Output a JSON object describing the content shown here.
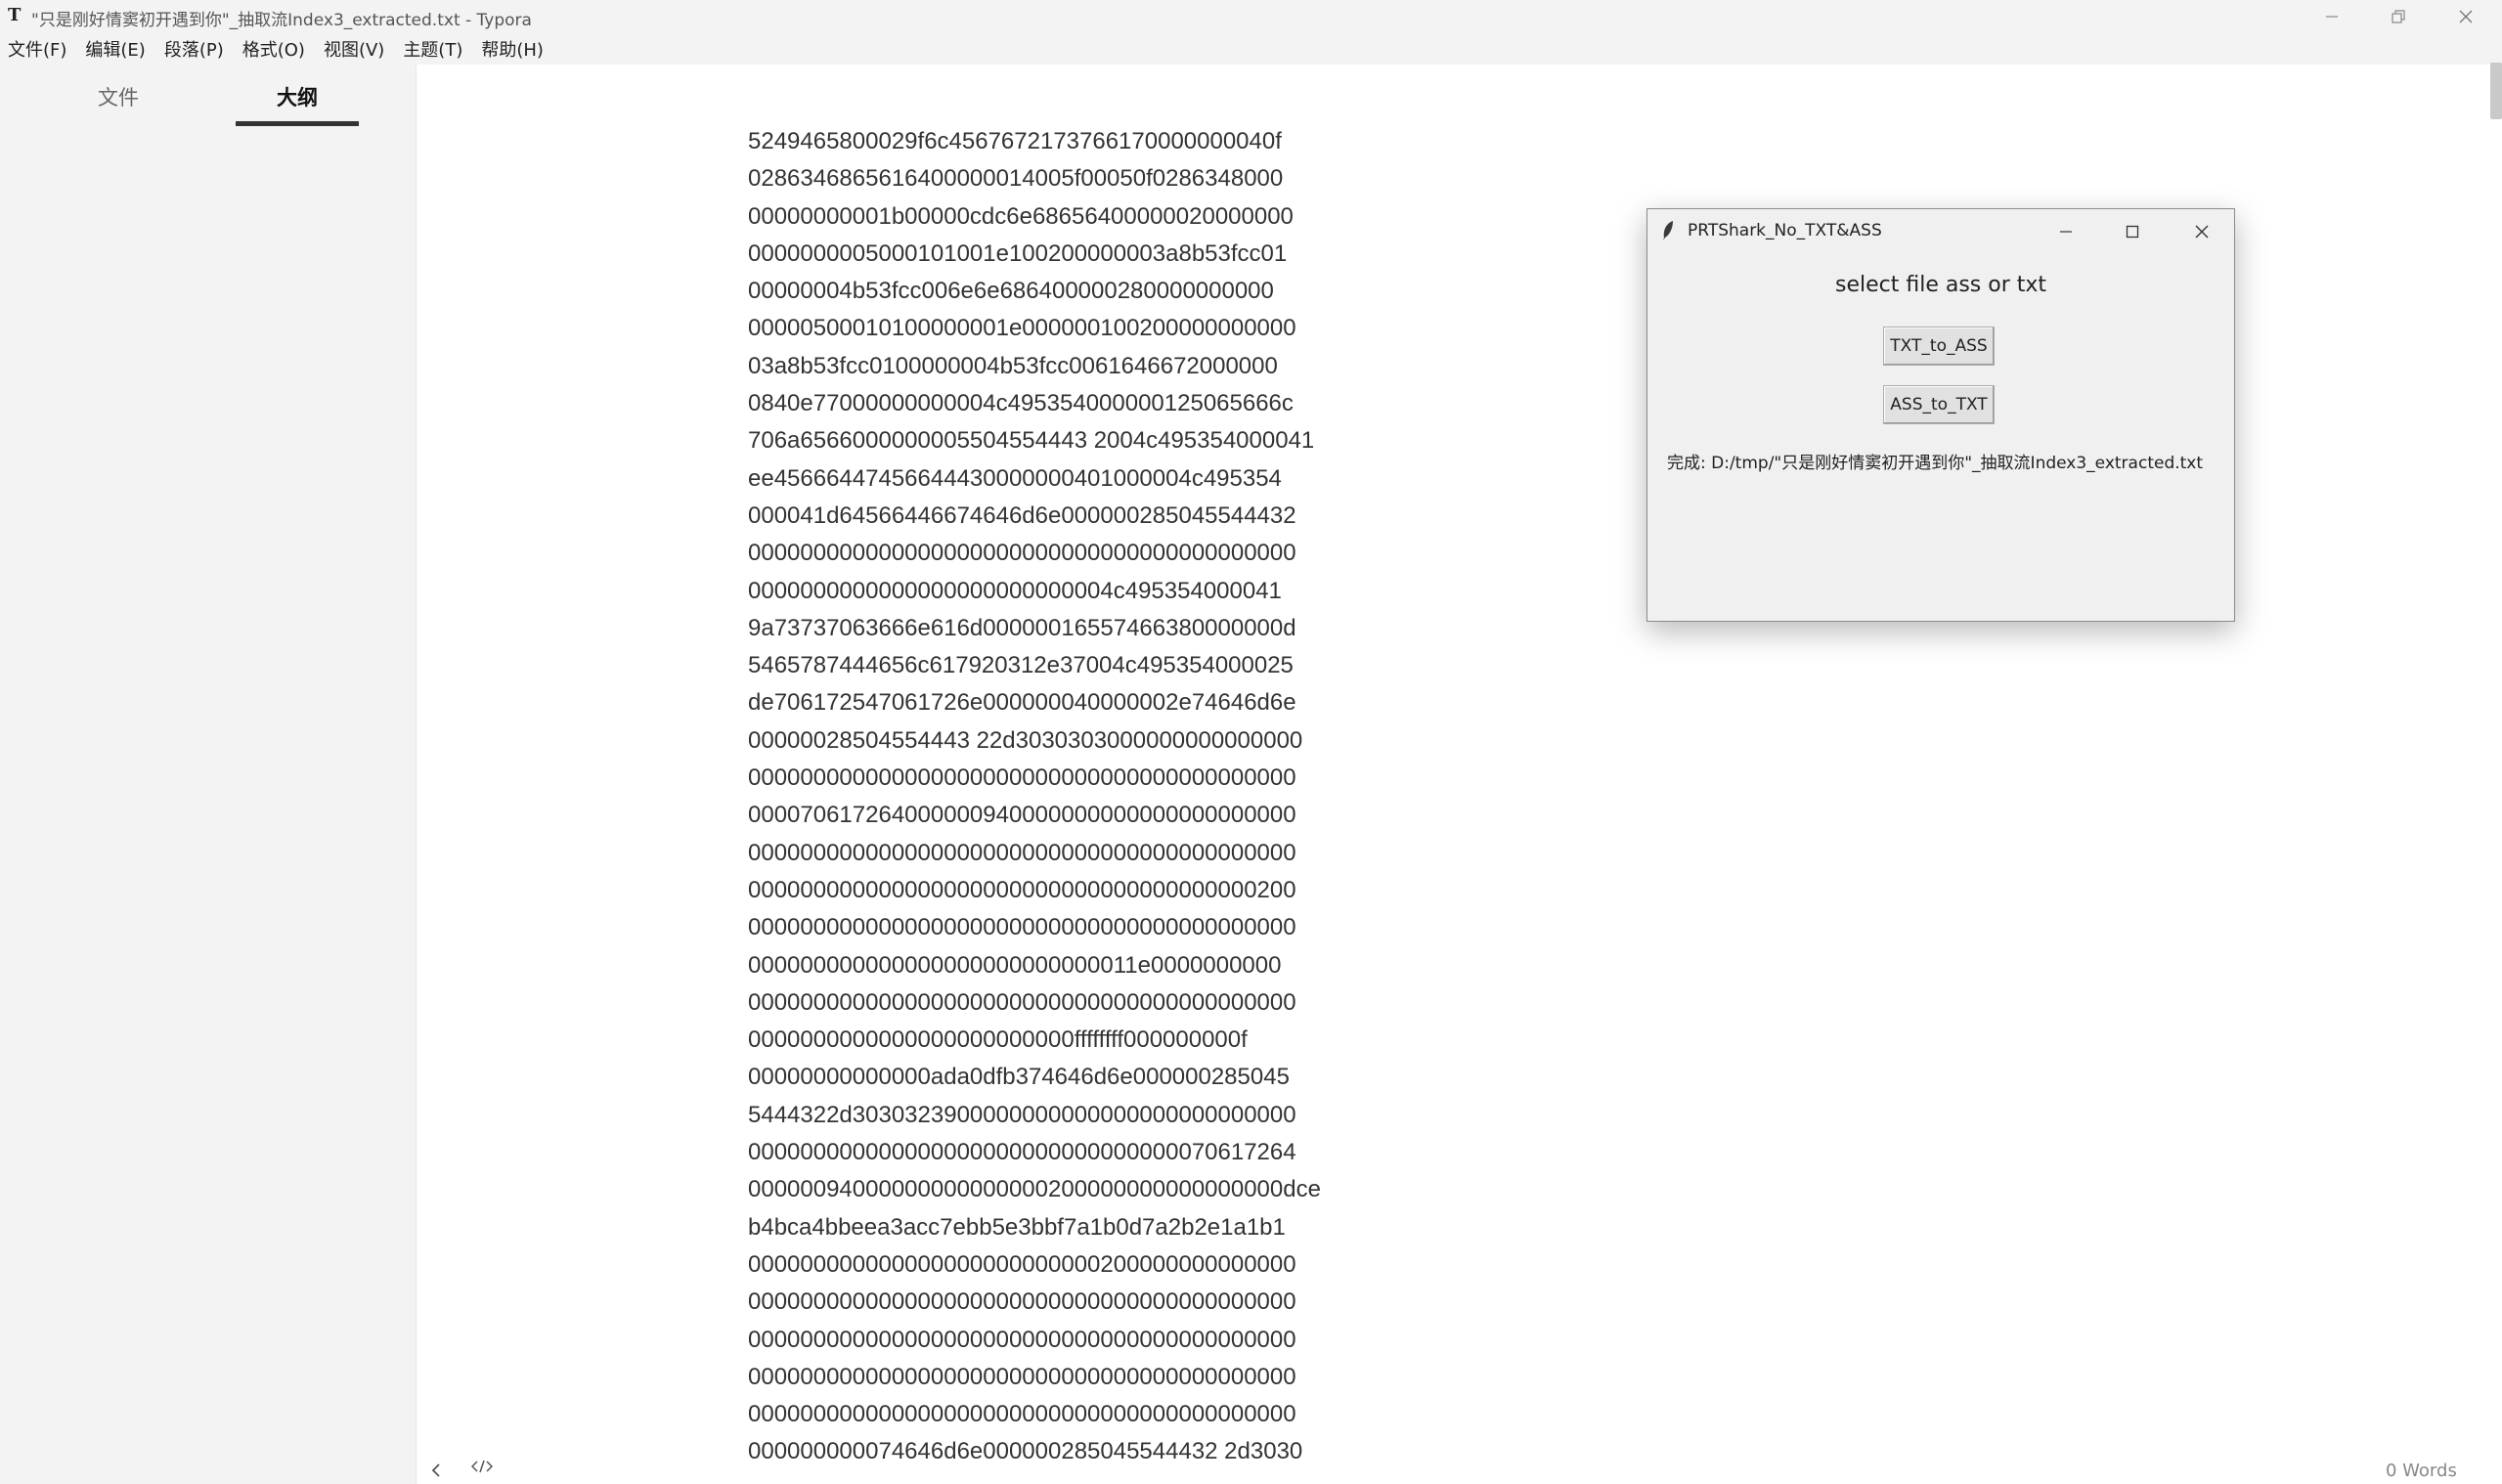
{
  "window": {
    "title": "\"只是刚好情窦初开遇到你\"_抽取流Index3_extracted.txt - Typora",
    "app_icon": "T"
  },
  "menu": [
    "文件(F)",
    "编辑(E)",
    "段落(P)",
    "格式(O)",
    "视图(V)",
    "主题(T)",
    "帮助(H)"
  ],
  "sidebar": {
    "tabs": [
      {
        "label": "文件",
        "active": false
      },
      {
        "label": "大纲",
        "active": true
      }
    ]
  },
  "document": {
    "lines": [
      "5249465800029f6c4567672173766170000000040f",
      "0286346865616400000014005f00050f0286348000",
      "00000000001b00000cdc6e68656400000020000000",
      "0000000005000101001e100200000003a8b53fcc01",
      "00000004b53fcc006e6e686400000280000000000",
      "00000500010100000001e000000100200000000000",
      "03a8b53fcc0100000004b53fcc0061646672000000",
      "0840e77000000000004c495354000000125065666c",
      "706a6566000000005504554443 2004c495354000041",
      "ee45666447456644430000000401000004c495354",
      "000041d64566446674646d6e000000285045544432",
      "000000000000000000000000000000000000000000",
      "0000000000000000000000000004c495354000041",
      "9a73737063666e616d00000016557466380000000d",
      "5465787444656c617920312e37004c495354000025",
      "de706172547061726e000000040000002e74646d6e",
      "00000028504554443 22d3030303000000000000000",
      "000000000000000000000000000000000000000000",
      "000070617264000000940000000000000000000000",
      "000000000000000000000000000000000000000000",
      "000000000000000000000000000000000000000200",
      "000000000000000000000000000000000000000000",
      "000000000000000000000000000011e0000000000",
      "000000000000000000000000000000000000000000",
      "0000000000000000000000000ffffffff000000000f",
      "00000000000000ada0dfb374646d6e000000285045",
      "5444322d3030323900000000000000000000000000",
      "000000000000000000000000000000000070617264",
      "00000094000000000000000200000000000000000dce",
      "b4bca4bbeea3acc7ebb5e3bbf7a1b0d7a2b2e1a1b1",
      "000000000000000000000000000200000000000000",
      "000000000000000000000000000000000000000000",
      "000000000000000000000000000000000000000000",
      "000000000000000000000000000000000000000000",
      "000000000000000000000000000000000000000000",
      "000000000074646d6e000000285045544432 2d3030"
    ],
    "word_count": "0 Words"
  },
  "dialog": {
    "title": "PRTShark_No_TXT&ASS",
    "prompt": "select file ass or txt",
    "button_txt_to_ass": "TXT_to_ASS",
    "button_ass_to_txt": "ASS_to_TXT",
    "status": "完成: D:/tmp/\"只是刚好情窦初开遇到你\"_抽取流Index3_extracted.txt"
  },
  "icons": {
    "app": "typora-icon",
    "minimize": "minimize-icon",
    "maximize": "restore-icon",
    "close": "close-icon",
    "dialog_app": "feather-icon",
    "back": "chevron-left-icon",
    "source": "code-icon"
  }
}
